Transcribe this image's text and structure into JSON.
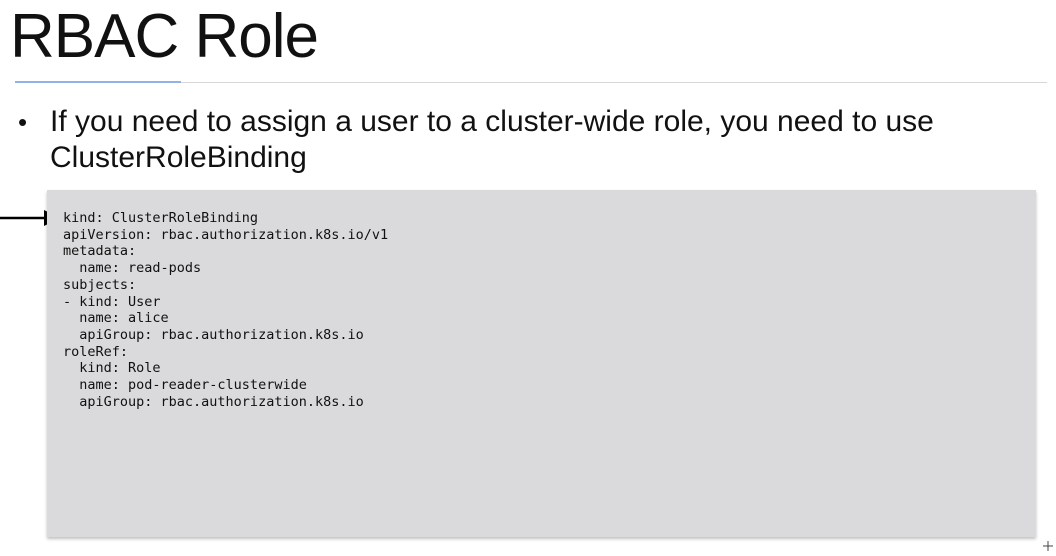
{
  "slide": {
    "title": "RBAC Role",
    "bullet": {
      "marker": "•",
      "text": "If you need to assign a user to a cluster-wide role, you need to use ClusterRoleBinding"
    },
    "code": {
      "lines": [
        "kind: ClusterRoleBinding",
        "apiVersion: rbac.authorization.k8s.io/v1",
        "metadata:",
        "  name: read-pods",
        "subjects:",
        "- kind: User",
        "  name: alice",
        "  apiGroup: rbac.authorization.k8s.io",
        "roleRef:",
        "  kind: Role",
        "  name: pod-reader-clusterwide",
        "  apiGroup: rbac.authorization.k8s.io"
      ]
    },
    "colors": {
      "background": "#ffffff",
      "title_text": "#111111",
      "accent_rule": "#8fb2e8",
      "code_background": "#dadadc",
      "arrow": "#000000"
    },
    "icons": {
      "pointer": "right-arrow-icon"
    }
  }
}
